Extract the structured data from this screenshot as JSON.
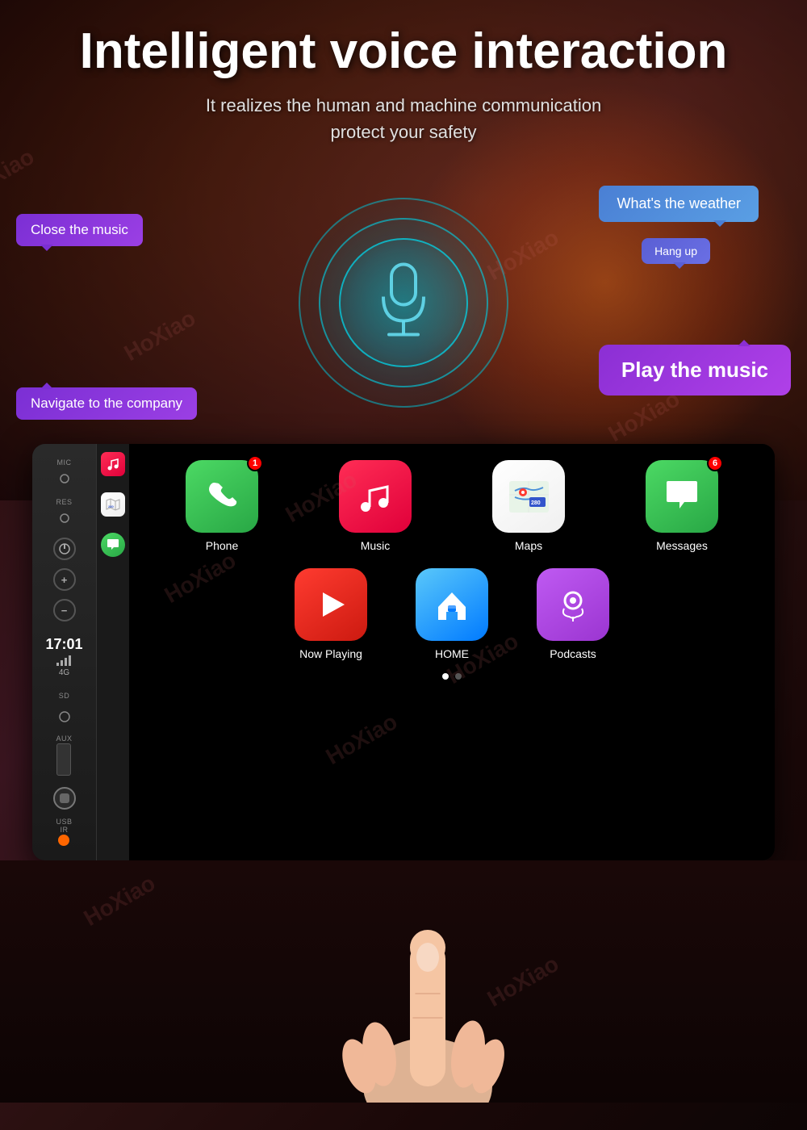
{
  "page": {
    "title": "Intelligent voice interaction",
    "subtitle_line1": "It realizes the human and machine communication",
    "subtitle_line2": "protect your safety"
  },
  "bubbles": {
    "close_music": "Close the music",
    "navigate": "Navigate to the company",
    "weather": "What's the weather",
    "hangup": "Hang up",
    "play_music": "Play the music"
  },
  "device": {
    "time": "17:01",
    "network": "4G",
    "labels": {
      "mic": "MIC",
      "res": "RES",
      "sd": "SD",
      "aux": "AUX",
      "usb_ir": "USB\nIR"
    }
  },
  "apps": {
    "row1": [
      {
        "name": "Phone",
        "badge": "1",
        "color_start": "#4cd964",
        "color_end": "#28a745"
      },
      {
        "name": "Music",
        "badge": "",
        "color_start": "#ff2d55",
        "color_end": "#e0003a"
      },
      {
        "name": "Maps",
        "badge": "",
        "color_start": "#ffffff",
        "color_end": "#f0f0f0"
      },
      {
        "name": "Messages",
        "badge": "6",
        "color_start": "#4cd964",
        "color_end": "#28a745"
      }
    ],
    "row2": [
      {
        "name": "Now Playing",
        "badge": "",
        "color_start": "#ff3b30",
        "color_end": "#cc1a10"
      },
      {
        "name": "HOME",
        "badge": "",
        "color_start": "#5ac8fa",
        "color_end": "#007aff"
      },
      {
        "name": "Podcasts",
        "badge": "",
        "color_start": "#bf5af2",
        "color_end": "#9b35d1"
      }
    ]
  },
  "page_dots": [
    "active",
    "inactive"
  ],
  "watermark": "HoXiao"
}
